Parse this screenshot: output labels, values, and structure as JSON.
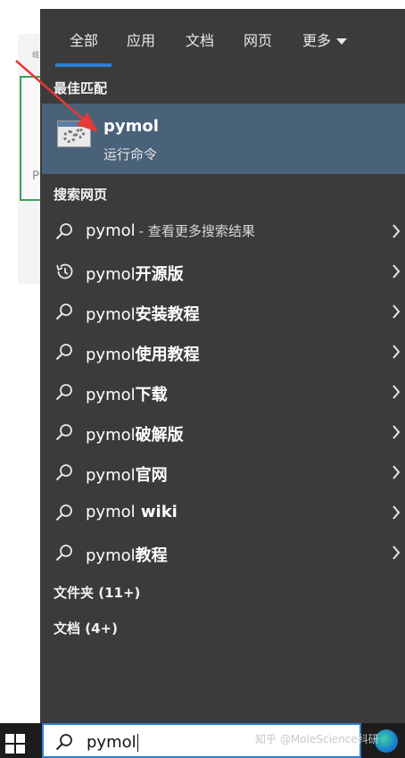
{
  "background": {
    "tiny_text": "组",
    "card_label": "Py"
  },
  "tabs": [
    {
      "label": "全部",
      "active": true
    },
    {
      "label": "应用",
      "active": false
    },
    {
      "label": "文档",
      "active": false
    },
    {
      "label": "网页",
      "active": false
    },
    {
      "label": "更多",
      "active": false,
      "has_dropdown": true
    }
  ],
  "best_match": {
    "section_title": "最佳匹配",
    "name": "pymol",
    "subtitle": "运行命令",
    "icon": "run-command-icon"
  },
  "web_search": {
    "section_title": "搜索网页",
    "items": [
      {
        "query": "pymol",
        "suffix": "",
        "sub": "- 查看更多搜索结果",
        "icon": "search-icon"
      },
      {
        "query": "pymol",
        "suffix": "开源版",
        "sub": "",
        "icon": "history-icon"
      },
      {
        "query": "pymol",
        "suffix": "安装教程",
        "sub": "",
        "icon": "search-icon"
      },
      {
        "query": "pymol",
        "suffix": "使用教程",
        "sub": "",
        "icon": "search-icon"
      },
      {
        "query": "pymol",
        "suffix": "下载",
        "sub": "",
        "icon": "search-icon"
      },
      {
        "query": "pymol",
        "suffix": "破解版",
        "sub": "",
        "icon": "search-icon"
      },
      {
        "query": "pymol",
        "suffix": "官网",
        "sub": "",
        "icon": "search-icon"
      },
      {
        "query": "pymol",
        "suffix": " wiki",
        "sub": "",
        "icon": "search-icon"
      },
      {
        "query": "pymol",
        "suffix": "教程",
        "sub": "",
        "icon": "search-icon"
      }
    ]
  },
  "folders": {
    "label": "文件夹 (11+)"
  },
  "documents": {
    "label": "文档 (4+)"
  },
  "taskbar": {
    "search_value": "pymol",
    "watermark": "知乎 @MoleScience科研"
  },
  "colors": {
    "panel_bg": "#3b3b3b",
    "best_match_bg": "#4a6279",
    "accent": "#2f7fd1",
    "annotation_arrow": "#e53935"
  }
}
